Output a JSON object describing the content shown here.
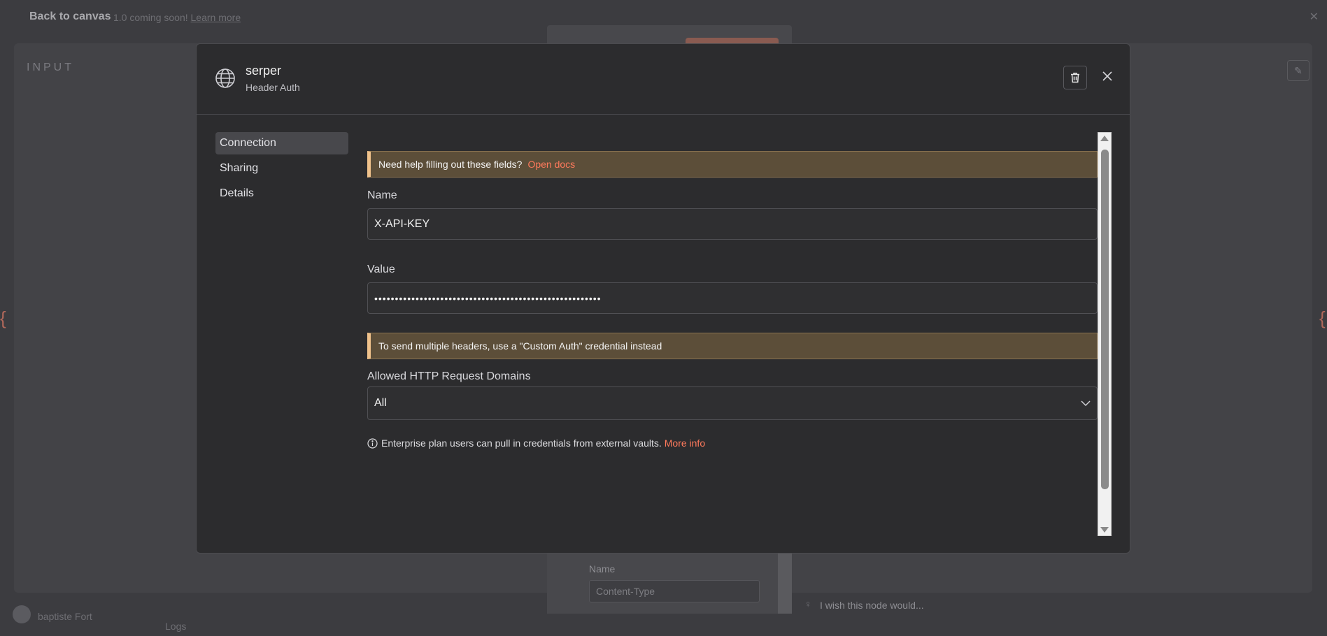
{
  "background": {
    "back_to_canvas": "Back to canvas",
    "coming_soon": "1.0 coming soon!",
    "learn_more": "Learn more",
    "input_title": "INPUT",
    "name_label": "Name",
    "content_type_placeholder": "Content-Type",
    "wish_text": "I wish this node would...",
    "username": "baptiste Fort",
    "logs_label": "Logs"
  },
  "modal": {
    "credential_name": "serper",
    "credential_type": "Header Auth",
    "sidebar": {
      "items": [
        {
          "label": "Connection",
          "active": true
        },
        {
          "label": "Sharing",
          "active": false
        },
        {
          "label": "Details",
          "active": false
        }
      ]
    },
    "help_callout": {
      "text": "Need help filling out these fields?",
      "link": "Open docs"
    },
    "name_field": {
      "label": "Name",
      "value": "X-API-KEY"
    },
    "value_field": {
      "label": "Value",
      "masked_value": "•••••••••••••••••••••••••••••••••••••••••••••••••••••••"
    },
    "headers_callout": {
      "text": "To send multiple headers, use a \"Custom Auth\" credential instead"
    },
    "domains_field": {
      "label": "Allowed HTTP Request Domains",
      "selected": "All"
    },
    "enterprise_note": {
      "text": "Enterprise plan users can pull in credentials from external vaults.",
      "link": "More info"
    }
  },
  "colors": {
    "accent_link": "#ff7a5c",
    "callout_bg": "#5c4e39",
    "callout_border": "#f0c28b",
    "modal_bg": "#2c2c2e"
  }
}
